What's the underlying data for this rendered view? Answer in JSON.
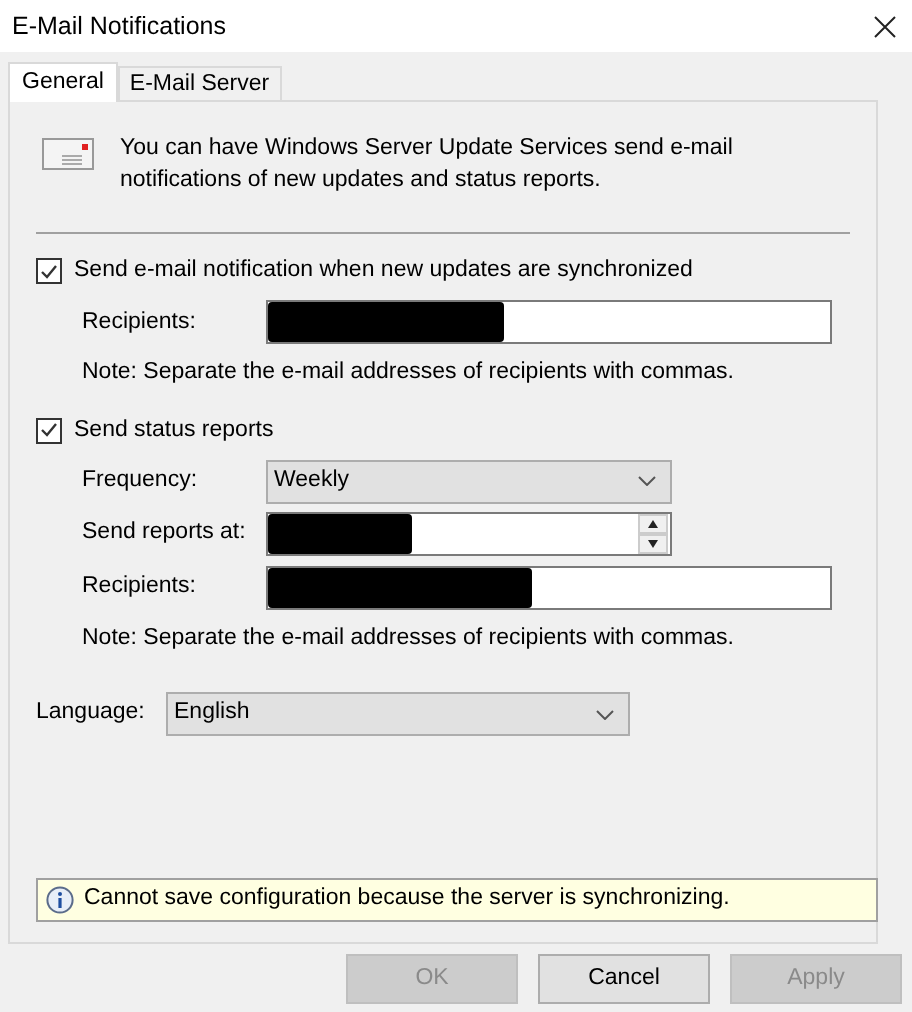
{
  "window": {
    "title": "E-Mail Notifications"
  },
  "tabs": [
    {
      "label": "General",
      "selected": true
    },
    {
      "label": "E-Mail Server",
      "selected": false
    }
  ],
  "intro": "You can have Windows Server Update Services send e-mail notifications of new updates and status reports.",
  "sync_notification": {
    "label": "Send e-mail notification when new updates are synchronized",
    "checked": true,
    "recipients": {
      "label": "Recipients:",
      "redacted": true
    },
    "note": "Note: Separate the e-mail addresses of recipients with commas."
  },
  "status_reports": {
    "label": "Send status reports",
    "checked": true,
    "frequency": {
      "label": "Frequency:",
      "value": "Weekly"
    },
    "send_at": {
      "label": "Send reports at:",
      "redacted": true
    },
    "recipients": {
      "label": "Recipients:",
      "redacted": true
    },
    "note": "Note: Separate the e-mail addresses of recipients with commas."
  },
  "language": {
    "label": "Language:",
    "value": "English"
  },
  "info_bar": "Cannot save configuration because the server is synchronizing.",
  "buttons": [
    {
      "label": "OK",
      "disabled": true
    },
    {
      "label": "Cancel",
      "disabled": false
    },
    {
      "label": "Apply",
      "disabled": true
    }
  ]
}
